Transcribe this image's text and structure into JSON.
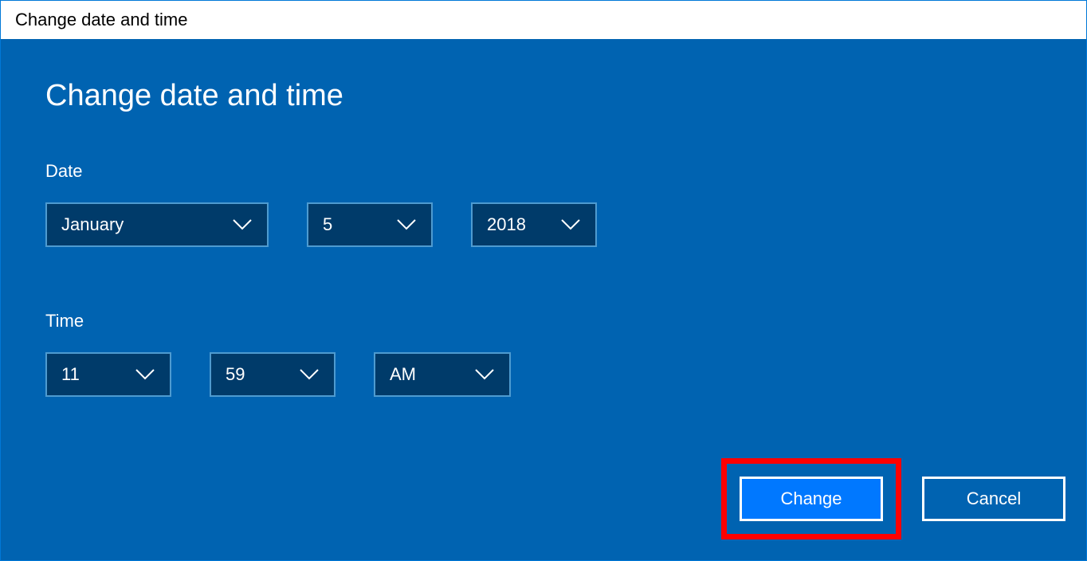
{
  "titlebar": {
    "title": "Change date and time"
  },
  "heading": "Change date and time",
  "labels": {
    "date": "Date",
    "time": "Time"
  },
  "date": {
    "month": "January",
    "day": "5",
    "year": "2018"
  },
  "time": {
    "hour": "11",
    "minute": "59",
    "ampm": "AM"
  },
  "buttons": {
    "change": "Change",
    "cancel": "Cancel"
  }
}
